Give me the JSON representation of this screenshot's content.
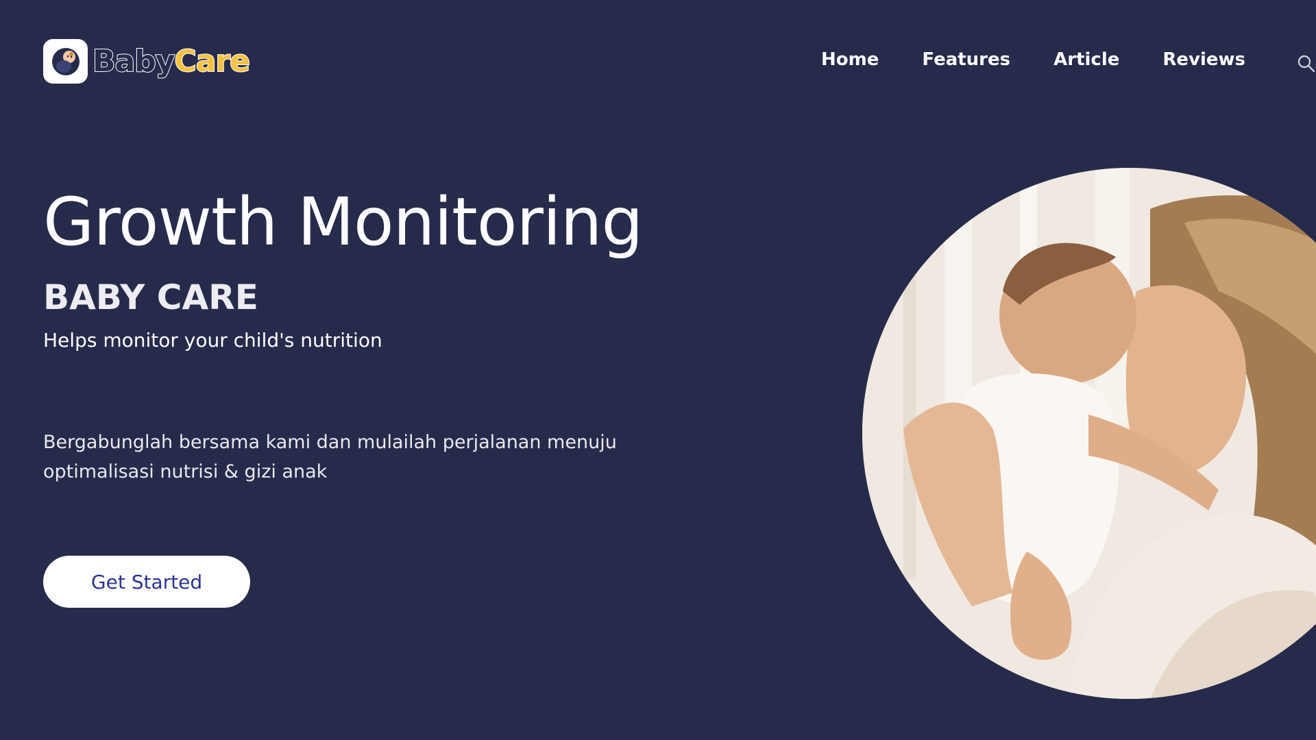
{
  "brand": {
    "name_part1": "Baby",
    "name_part2": "Care",
    "logo_icon": "baby-logo-icon",
    "accent_color": "#f5c242",
    "background_color": "#272b4b"
  },
  "nav": {
    "items": [
      {
        "label": "Home"
      },
      {
        "label": "Features"
      },
      {
        "label": "Article"
      },
      {
        "label": "Reviews"
      }
    ],
    "search_icon": "search-icon"
  },
  "hero": {
    "title": "Growth Monitoring",
    "subtitle": "BABY CARE",
    "tagline": "Helps monitor your child's nutrition",
    "description": "Bergabunglah bersama kami dan mulailah perjalanan menuju optimalisasi nutrisi & gizi anak",
    "cta_label": "Get Started",
    "cta_text_color": "#2c3493"
  },
  "image": {
    "subject": "mother-and-baby-photo"
  }
}
